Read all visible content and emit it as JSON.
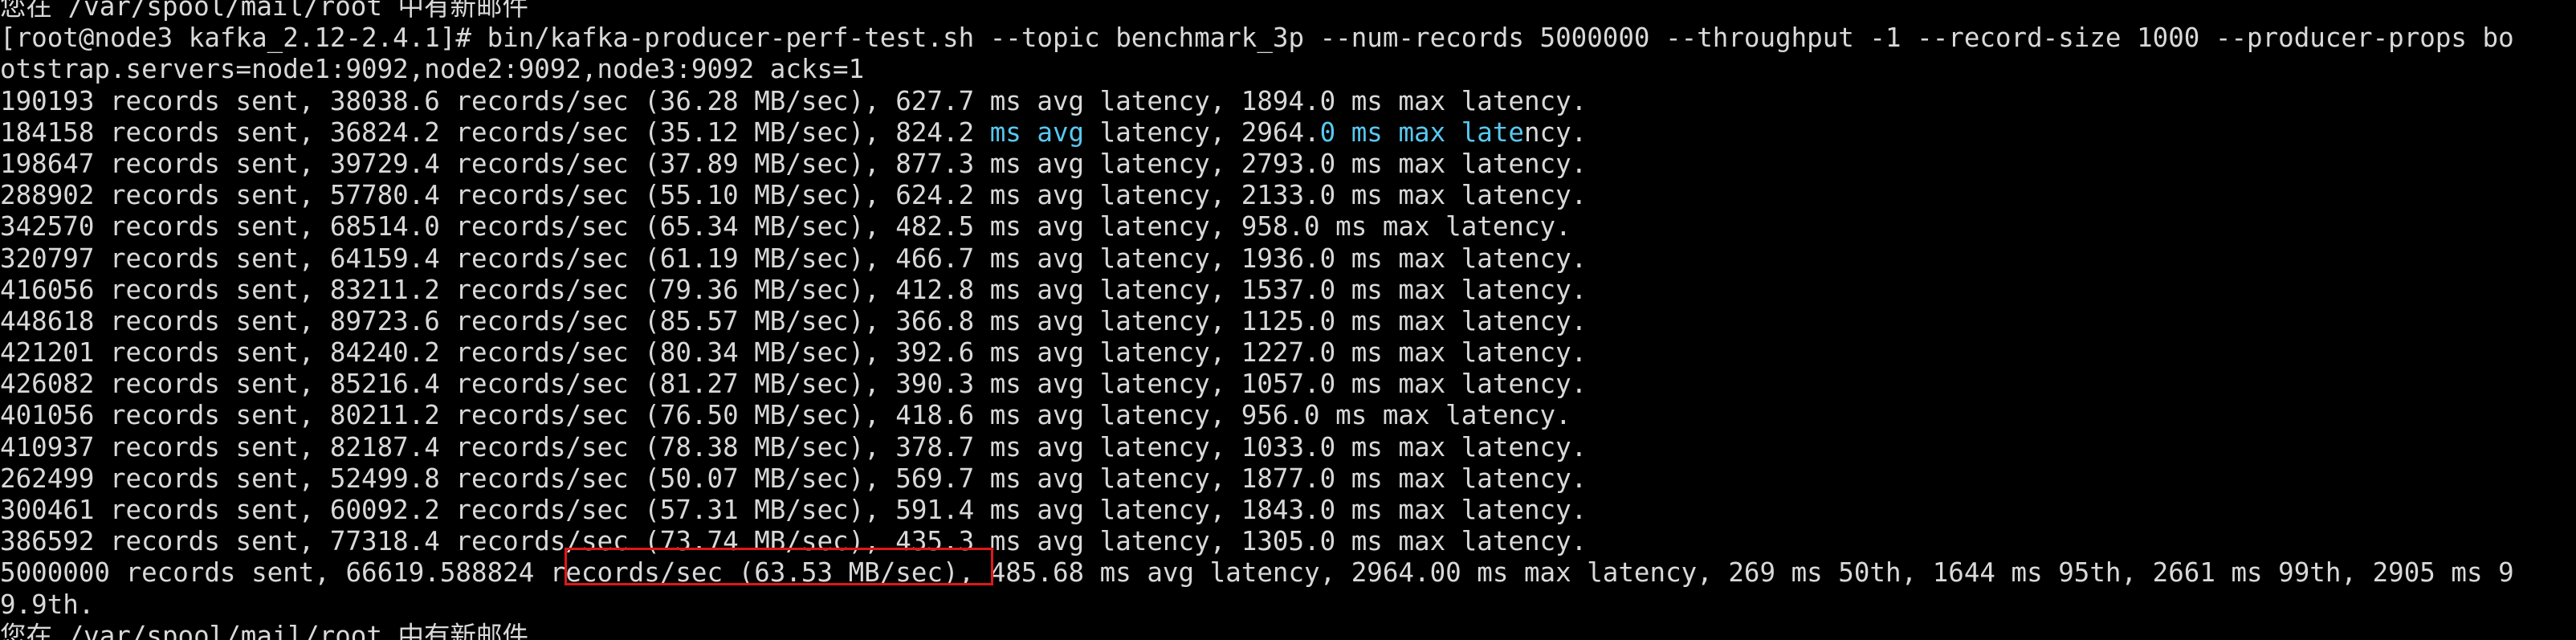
{
  "terminal": {
    "lines": [
      [
        {
          "t": "您在 /var/spool/mail/root 中有新邮件",
          "c": ""
        }
      ],
      [
        {
          "t": "[root@node3 kafka_2.12-2.4.1]# bin/kafka-producer-perf-test.sh --topic benchmark_3p --num-records 5000000 --throughput -1 --record-size 1000 --producer-props bo",
          "c": ""
        }
      ],
      [
        {
          "t": "otstrap.servers=node1:9092,node2:9092,node3:9092 acks=1",
          "c": ""
        }
      ],
      [
        {
          "t": "190193 records sent, 38038.6 records/sec (36.28 MB/sec), 627.7 ms avg latency, 1894.0 ms max latency.",
          "c": ""
        }
      ],
      [
        {
          "t": "184158 records sent, 36824.2 records/sec (35.12 MB/sec), 824.2 ",
          "c": ""
        },
        {
          "t": "ms avg",
          "c": "cyan"
        },
        {
          "t": " latency, 2964.",
          "c": ""
        },
        {
          "t": "0 ms max late",
          "c": "cyan"
        },
        {
          "t": "ncy.",
          "c": ""
        }
      ],
      [
        {
          "t": "198647 records sent, 39729.4 records/sec (37.89 MB/sec), 877.3 ms avg latency, 2793.0 ms max latency.",
          "c": ""
        }
      ],
      [
        {
          "t": "288902 records sent, 57780.4 records/sec (55.10 MB/sec), 624.2 ms avg latency, 2133.0 ms max latency.",
          "c": ""
        }
      ],
      [
        {
          "t": "342570 records sent, 68514.0 records/sec (65.34 MB/sec), 482.5 ms avg latency, 958.0 ms max latency.",
          "c": ""
        }
      ],
      [
        {
          "t": "320797 records sent, 64159.4 records/sec (61.19 MB/sec), 466.7 ms avg latency, 1936.0 ms max latency.",
          "c": ""
        }
      ],
      [
        {
          "t": "416056 records sent, 83211.2 records/sec (79.36 MB/sec), 412.8 ms avg latency, 1537.0 ms max latency.",
          "c": ""
        }
      ],
      [
        {
          "t": "448618 records sent, 89723.6 records/sec (85.57 MB/sec), 366.8 ms avg latency, 1125.0 ms max latency.",
          "c": ""
        }
      ],
      [
        {
          "t": "421201 records sent, 84240.2 records/sec (80.34 MB/sec), 392.6 ms avg latency, 1227.0 ms max latency.",
          "c": ""
        }
      ],
      [
        {
          "t": "426082 records sent, 85216.4 records/sec (81.27 MB/sec), 390.3 ms avg latency, 1057.0 ms max latency.",
          "c": ""
        }
      ],
      [
        {
          "t": "401056 records sent, 80211.2 records/sec (76.50 MB/sec), 418.6 ms avg latency, 956.0 ms max latency.",
          "c": ""
        }
      ],
      [
        {
          "t": "410937 records sent, 82187.4 records/sec (78.38 MB/sec), 378.7 ms avg latency, 1033.0 ms max latency.",
          "c": ""
        }
      ],
      [
        {
          "t": "262499 records sent, 52499.8 records/sec (50.07 MB/sec), 569.7 ms avg latency, 1877.0 ms max latency.",
          "c": ""
        }
      ],
      [
        {
          "t": "300461 records sent, 60092.2 records/sec (57.31 MB/sec), 591.4 ms avg latency, 1843.0 ms max latency.",
          "c": ""
        }
      ],
      [
        {
          "t": "386592 records sent, 77318.4 records/sec (73.74 MB/sec), 435.3 ms avg latency, 1305.0 ms max latency.",
          "c": ""
        }
      ],
      [
        {
          "t": "5000000 records sent, 66619.588824 records/sec (63.53 MB/sec), 485.68 ms avg latency, 2964.00 ms max latency, 269 ms 50th, 1644 ms 95th, 2661 ms 99th, 2905 ms 9",
          "c": ""
        }
      ],
      [
        {
          "t": "9.9th.",
          "c": ""
        }
      ],
      [
        {
          "t": "您在 /var/spool/mail/root 中有新邮件",
          "c": ""
        }
      ]
    ]
  },
  "colors": {
    "background": "#000000",
    "foreground": "#d9d9d9",
    "selection_cyan": "#58c8f0",
    "highlight_box": "#e01818"
  }
}
